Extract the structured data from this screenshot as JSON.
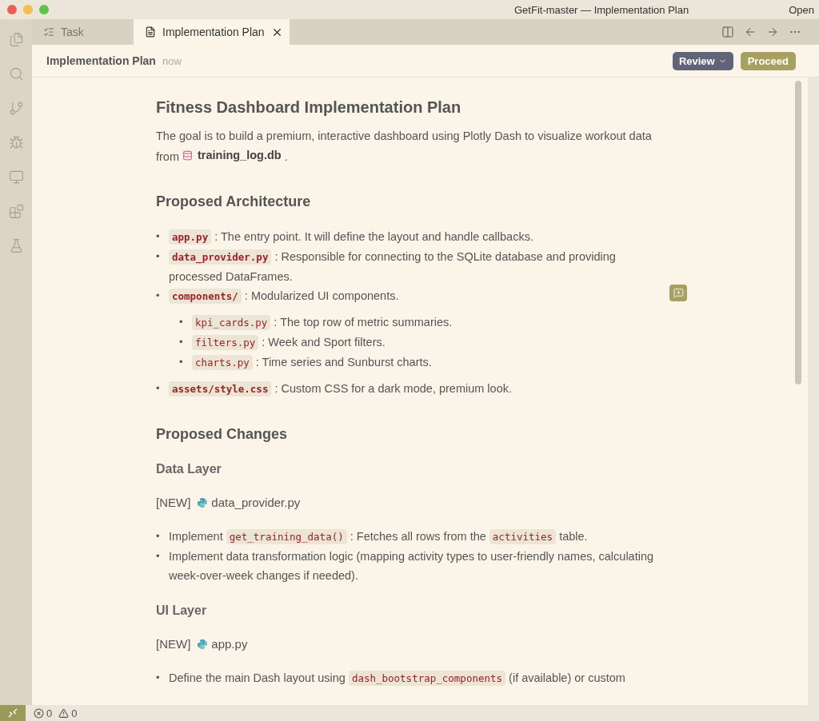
{
  "window": {
    "title": "GetFit-master — Implementation Plan",
    "menu_text": "Open"
  },
  "tabs": [
    {
      "label": "Task",
      "kind": "task",
      "selected": false
    },
    {
      "label": "Implementation Plan",
      "kind": "document",
      "selected": true
    }
  ],
  "header": {
    "title": "Implementation Plan",
    "time": "now",
    "review_button": "Review",
    "proceed_button": "Proceed"
  },
  "content": [
    {
      "kind": "h1",
      "text": "Fitness Dashboard Implementation Plan"
    },
    {
      "kind": "paragraph",
      "parts": [
        {
          "kind": "text",
          "text": "The goal is to build a premium, interactive dashboard using Plotly Dash to visualize workout data from"
        },
        {
          "kind": "database",
          "text": "training_log.db"
        },
        {
          "kind": "text",
          "text": "."
        }
      ]
    },
    {
      "kind": "h2",
      "text": "Proposed Architecture"
    },
    {
      "kind": "list",
      "marker": "•",
      "items": [
        {
          "parts": [
            {
              "kind": "code",
              "text": "app.py"
            },
            {
              "kind": "text",
              "text": ": The entry point. It will define the layout and handle callbacks."
            }
          ]
        },
        {
          "parts": [
            {
              "kind": "code",
              "text": "data_provider.py"
            },
            {
              "kind": "text",
              "text": ": Responsible for connecting to the SQLite database and providing processed DataFrames."
            }
          ]
        },
        {
          "parts": [
            {
              "kind": "code",
              "text": "components/"
            },
            {
              "kind": "text",
              "text": ": Modularized UI components."
            }
          ],
          "marker": "•",
          "children": [
            {
              "parts": [
                {
                  "kind": "code",
                  "text": "kpi_cards.py"
                },
                {
                  "kind": "text",
                  "text": ": The top row of metric summaries."
                }
              ]
            },
            {
              "parts": [
                {
                  "kind": "code",
                  "text": "filters.py"
                },
                {
                  "kind": "text",
                  "text": ": Week and Sport filters."
                }
              ]
            },
            {
              "parts": [
                {
                  "kind": "code",
                  "text": "charts.py"
                },
                {
                  "kind": "text",
                  "text": ": Time series and Sunburst charts."
                }
              ]
            }
          ]
        },
        {
          "parts": [
            {
              "kind": "code",
              "text": "assets/style.css"
            },
            {
              "kind": "text",
              "text": ": Custom CSS for a dark mode, premium look."
            }
          ]
        }
      ]
    },
    {
      "kind": "h2",
      "text": "Proposed Changes"
    },
    {
      "kind": "h3",
      "text": "Data Layer"
    },
    {
      "kind": "file_heading",
      "tag": "[NEW]",
      "file": "data_provider.py"
    },
    {
      "kind": "list",
      "marker": "•",
      "items": [
        {
          "parts": [
            {
              "kind": "text",
              "text": "Implement"
            },
            {
              "kind": "code",
              "text": "get_training_data()"
            },
            {
              "kind": "text",
              "text": ": Fetches all rows from the"
            },
            {
              "kind": "code",
              "text": "activities"
            },
            {
              "kind": "text",
              "text": "table."
            }
          ]
        },
        {
          "parts": [
            {
              "kind": "text",
              "text": "Implement data transformation logic (mapping activity types to user-friendly names, calculating week-over-week changes if needed)."
            }
          ]
        }
      ]
    },
    {
      "kind": "h3",
      "text": "UI Layer"
    },
    {
      "kind": "file_heading",
      "tag": "[NEW]",
      "file": "app.py"
    },
    {
      "kind": "list",
      "marker": "•",
      "items": [
        {
          "parts": [
            {
              "kind": "text",
              "text": "Define the main Dash layout using"
            },
            {
              "kind": "code",
              "text": "dash_bootstrap_components"
            },
            {
              "kind": "text",
              "text": "(if available) or custom"
            }
          ]
        }
      ]
    }
  ],
  "status_bar": {
    "errors": "0",
    "warnings": "0"
  }
}
